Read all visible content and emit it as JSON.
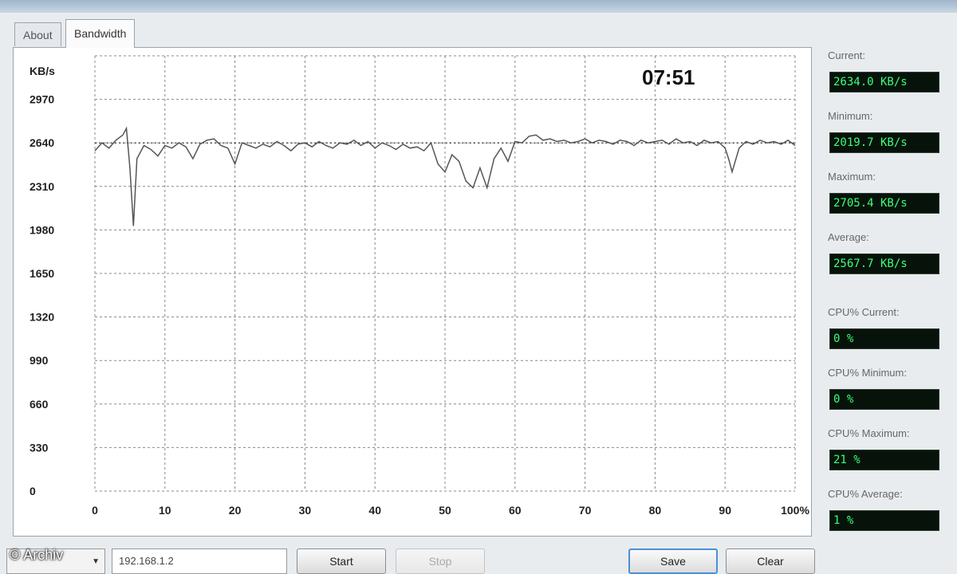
{
  "tabs": [
    {
      "label": "About",
      "active": false
    },
    {
      "label": "Bandwidth",
      "active": true
    }
  ],
  "stats": [
    {
      "label": "Current:",
      "value": "2634.0 KB/s"
    },
    {
      "label": "Minimum:",
      "value": "2019.7 KB/s"
    },
    {
      "label": "Maximum:",
      "value": "2705.4 KB/s"
    },
    {
      "label": "Average:",
      "value": "2567.7 KB/s"
    },
    {
      "label": "CPU% Current:",
      "value": "0 %"
    },
    {
      "label": "CPU% Minimum:",
      "value": "0 %"
    },
    {
      "label": "CPU% Maximum:",
      "value": "21 %"
    },
    {
      "label": "CPU% Average:",
      "value": "1 %"
    }
  ],
  "bottom": {
    "ip_value": "192.168.1.2",
    "start_label": "Start",
    "stop_label": "Stop",
    "save_label": "Save",
    "clear_label": "Clear"
  },
  "watermark": "© Archiv",
  "chart_data": {
    "type": "line",
    "timer": "07:51",
    "ylabel": "KB/s",
    "y_ticks": [
      0,
      330,
      660,
      990,
      1320,
      1650,
      1980,
      2310,
      2640,
      2970
    ],
    "x_ticks": [
      "0",
      "10",
      "20",
      "30",
      "40",
      "50",
      "60",
      "70",
      "80",
      "90",
      "100%"
    ],
    "ylim": [
      0,
      3300
    ],
    "xlim": [
      0,
      100
    ],
    "grid": true,
    "reference_line": 2640,
    "colors": {
      "line": "#555555",
      "grid": "#888888"
    },
    "series": [
      {
        "x": [
          0,
          1,
          2,
          3,
          4,
          4.5,
          5,
          5.5,
          6,
          7,
          8,
          9,
          10,
          11,
          12,
          13,
          14,
          15,
          16,
          17,
          18,
          19,
          20,
          21,
          22,
          23,
          24,
          25,
          26,
          27,
          28,
          29,
          30,
          31,
          32,
          33,
          34,
          35,
          36,
          37,
          38,
          39,
          40,
          41,
          42,
          43,
          44,
          45,
          46,
          47,
          48,
          49,
          50,
          51,
          52,
          53,
          54,
          55,
          56,
          57,
          58,
          59,
          60,
          61,
          62,
          63,
          64,
          65,
          66,
          67,
          68,
          69,
          70,
          71,
          72,
          73,
          74,
          75,
          76,
          77,
          78,
          79,
          80,
          81,
          82,
          83,
          84,
          85,
          86,
          87,
          88,
          89,
          90,
          90.5,
          91,
          92,
          93,
          94,
          95,
          96,
          97,
          98,
          99,
          100
        ],
        "y": [
          2580,
          2640,
          2600,
          2660,
          2700,
          2750,
          2450,
          2010,
          2520,
          2620,
          2590,
          2540,
          2620,
          2600,
          2640,
          2610,
          2520,
          2630,
          2660,
          2670,
          2620,
          2600,
          2480,
          2640,
          2620,
          2600,
          2630,
          2610,
          2650,
          2620,
          2580,
          2630,
          2640,
          2610,
          2650,
          2620,
          2600,
          2640,
          2630,
          2660,
          2620,
          2650,
          2600,
          2640,
          2620,
          2590,
          2630,
          2600,
          2610,
          2580,
          2640,
          2480,
          2420,
          2550,
          2500,
          2350,
          2300,
          2450,
          2300,
          2520,
          2600,
          2500,
          2650,
          2640,
          2690,
          2700,
          2660,
          2670,
          2650,
          2660,
          2640,
          2650,
          2670,
          2640,
          2660,
          2650,
          2630,
          2660,
          2650,
          2620,
          2660,
          2640,
          2650,
          2660,
          2630,
          2670,
          2640,
          2650,
          2620,
          2660,
          2640,
          2650,
          2600,
          2520,
          2420,
          2600,
          2650,
          2630,
          2660,
          2640,
          2650,
          2630,
          2660,
          2620
        ]
      }
    ]
  }
}
